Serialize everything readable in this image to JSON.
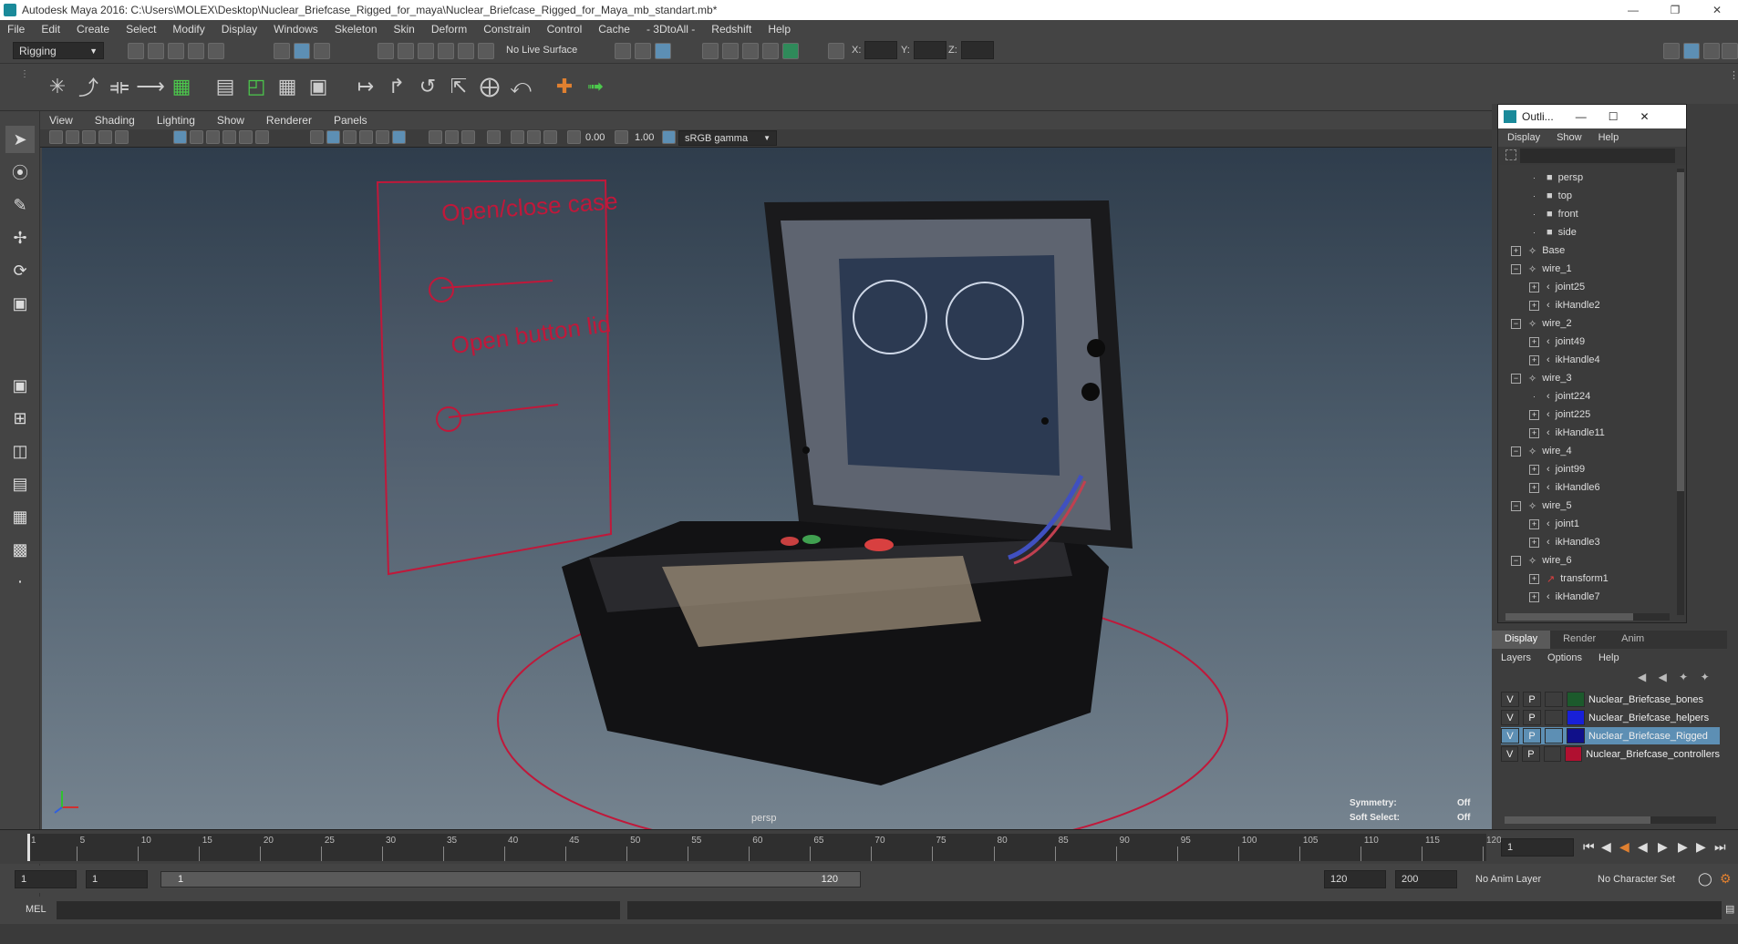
{
  "window": {
    "title": "Autodesk Maya 2016: C:\\Users\\MOLEX\\Desktop\\Nuclear_Briefcase_Rigged_for_maya\\Nuclear_Briefcase_Rigged_for_Maya_mb_standart.mb*"
  },
  "menubar": [
    "File",
    "Edit",
    "Create",
    "Select",
    "Modify",
    "Display",
    "Windows",
    "Skeleton",
    "Skin",
    "Deform",
    "Constrain",
    "Control",
    "Cache",
    "- 3DtoAll -",
    "Redshift",
    "Help"
  ],
  "status": {
    "mode": "Rigging",
    "live_surface": "No Live Surface",
    "x_label": "X:",
    "y_label": "Y:",
    "z_label": "Z:"
  },
  "viewport": {
    "menu": [
      "View",
      "Shading",
      "Lighting",
      "Show",
      "Renderer",
      "Panels"
    ],
    "near_value": "0.00",
    "far_value": "1.00",
    "color_space": "sRGB gamma",
    "camera_label": "persp",
    "symmetry_label": "Symmetry:",
    "symmetry_value": "Off",
    "soft_select_label": "Soft Select:",
    "soft_select_value": "Off",
    "annotation_1": "Open/close case",
    "annotation_2": "Open button lid"
  },
  "outliner": {
    "title": "Outli...",
    "menu": [
      "Display",
      "Show",
      "Help"
    ],
    "items": [
      {
        "label": "persp",
        "indent": 2,
        "icon": "camera"
      },
      {
        "label": "top",
        "indent": 2,
        "icon": "camera"
      },
      {
        "label": "front",
        "indent": 2,
        "icon": "camera"
      },
      {
        "label": "side",
        "indent": 2,
        "icon": "camera"
      },
      {
        "label": "Base",
        "indent": 1,
        "icon": "group",
        "exp": "+"
      },
      {
        "label": "wire_1",
        "indent": 1,
        "icon": "group",
        "exp": "-"
      },
      {
        "label": "joint25",
        "indent": 2,
        "icon": "joint",
        "exp": "+"
      },
      {
        "label": "ikHandle2",
        "indent": 2,
        "icon": "ik",
        "exp": "+"
      },
      {
        "label": "wire_2",
        "indent": 1,
        "icon": "group",
        "exp": "-"
      },
      {
        "label": "joint49",
        "indent": 2,
        "icon": "joint",
        "exp": "+"
      },
      {
        "label": "ikHandle4",
        "indent": 2,
        "icon": "ik",
        "exp": "+"
      },
      {
        "label": "wire_3",
        "indent": 1,
        "icon": "group",
        "exp": "-"
      },
      {
        "label": "joint224",
        "indent": 2,
        "icon": "joint",
        "exp": ""
      },
      {
        "label": "joint225",
        "indent": 2,
        "icon": "joint",
        "exp": "+"
      },
      {
        "label": "ikHandle11",
        "indent": 2,
        "icon": "ik",
        "exp": "+"
      },
      {
        "label": "wire_4",
        "indent": 1,
        "icon": "group",
        "exp": "-"
      },
      {
        "label": "joint99",
        "indent": 2,
        "icon": "joint",
        "exp": "+"
      },
      {
        "label": "ikHandle6",
        "indent": 2,
        "icon": "ik",
        "exp": "+"
      },
      {
        "label": "wire_5",
        "indent": 1,
        "icon": "group",
        "exp": "-"
      },
      {
        "label": "joint1",
        "indent": 2,
        "icon": "joint",
        "exp": "+"
      },
      {
        "label": "ikHandle3",
        "indent": 2,
        "icon": "ik",
        "exp": "+"
      },
      {
        "label": "wire_6",
        "indent": 1,
        "icon": "group",
        "exp": "-"
      },
      {
        "label": "transform1",
        "indent": 2,
        "icon": "transform",
        "exp": "+"
      },
      {
        "label": "ikHandle7",
        "indent": 2,
        "icon": "ik",
        "exp": "+"
      }
    ]
  },
  "layers": {
    "tabs": [
      "Display",
      "Render",
      "Anim"
    ],
    "menu": [
      "Layers",
      "Options",
      "Help"
    ],
    "rows": [
      {
        "v": "V",
        "p": "P",
        "color": "#1c5a2c",
        "name": "Nuclear_Briefcase_bones",
        "selected": false
      },
      {
        "v": "V",
        "p": "P",
        "color": "#1820d8",
        "name": "Nuclear_Briefcase_helpers",
        "selected": false
      },
      {
        "v": "V",
        "p": "P",
        "color": "#10108a",
        "name": "Nuclear_Briefcase_Rigged",
        "selected": true
      },
      {
        "v": "V",
        "p": "P",
        "color": "#b01030",
        "name": "Nuclear_Briefcase_controllers",
        "selected": false
      }
    ]
  },
  "timeline": {
    "ticks": [
      "1",
      "5",
      "10",
      "15",
      "20",
      "25",
      "30",
      "35",
      "40",
      "45",
      "50",
      "55",
      "60",
      "65",
      "70",
      "75",
      "80",
      "85",
      "90",
      "95",
      "100",
      "105",
      "110",
      "115",
      "120"
    ],
    "current_frame": "1"
  },
  "range": {
    "start": "1",
    "start_inner": "1",
    "slider_start": "1",
    "slider_end": "120",
    "end_inner": "120",
    "end": "200",
    "anim_layer": "No Anim Layer",
    "character_set": "No Character Set"
  },
  "cmdline": {
    "label": "MEL"
  },
  "colors": {
    "accent": "#5ba8c8",
    "selection": "#5d8fb4",
    "wire": "#c0183a"
  }
}
